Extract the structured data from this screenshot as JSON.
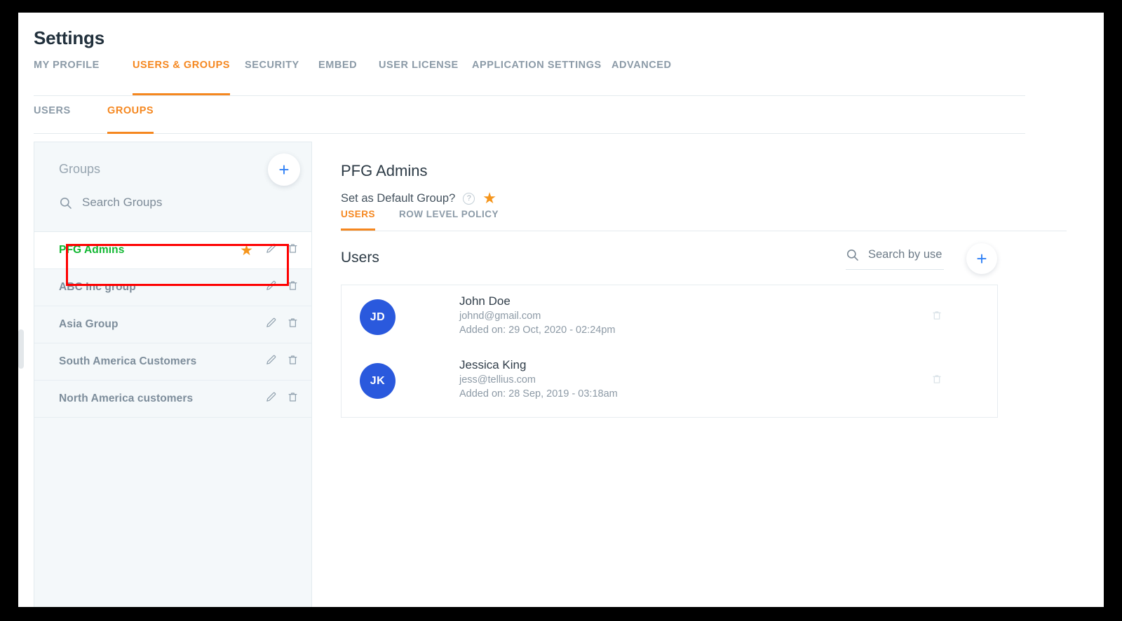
{
  "header": {
    "title": "Settings",
    "main_tabs": [
      {
        "label": "MY PROFILE",
        "active": false
      },
      {
        "label": "USERS & GROUPS",
        "active": true
      },
      {
        "label": "SECURITY",
        "active": false
      },
      {
        "label": "EMBED",
        "active": false
      },
      {
        "label": "USER LICENSE",
        "active": false
      },
      {
        "label": "APPLICATION SETTINGS",
        "active": false
      },
      {
        "label": "ADVANCED",
        "active": false
      }
    ],
    "sub_tabs": [
      {
        "label": "USERS",
        "active": false
      },
      {
        "label": "GROUPS",
        "active": true
      }
    ]
  },
  "sidebar": {
    "title": "Groups",
    "search_placeholder": "Search Groups",
    "add_button_label": "+",
    "icons": {
      "search": "search-icon",
      "add": "plus-icon",
      "edit": "pencil-icon",
      "delete": "trash-icon",
      "star": "star-icon"
    },
    "groups": [
      {
        "name": "PFG Admins",
        "selected": true,
        "is_default": true
      },
      {
        "name": "ABC Inc group",
        "selected": false,
        "is_default": false
      },
      {
        "name": "Asia Group",
        "selected": false,
        "is_default": false
      },
      {
        "name": "South America Customers",
        "selected": false,
        "is_default": false
      },
      {
        "name": "North America customers",
        "selected": false,
        "is_default": false
      }
    ]
  },
  "detail": {
    "group_name": "PFG Admins",
    "default_group_label": "Set as Default Group?",
    "help_icon_glyph": "?",
    "default_star_on": true,
    "tabs": [
      {
        "label": "USERS",
        "active": true
      },
      {
        "label": "ROW LEVEL POLICY",
        "active": false
      }
    ],
    "users_heading": "Users",
    "user_search_placeholder": "Search by use",
    "add_user_button_label": "+",
    "users": [
      {
        "initials": "JD",
        "name": "John Doe",
        "email": "johnd@gmail.com",
        "added": "Added on: 29 Oct, 2020 - 02:24pm"
      },
      {
        "initials": "JK",
        "name": "Jessica King",
        "email": "jess@tellius.com",
        "added": "Added on: 28 Sep, 2019 - 03:18am"
      }
    ]
  },
  "colors": {
    "accent_orange": "#f5871f",
    "selected_green": "#10b731",
    "avatar_blue": "#2a59dd",
    "link_blue": "#2f80f6",
    "star_orange": "#f5951c",
    "highlight_red": "#fe0000",
    "sidebar_bg": "#f4f8fa",
    "muted_text": "#8b9aa7"
  }
}
